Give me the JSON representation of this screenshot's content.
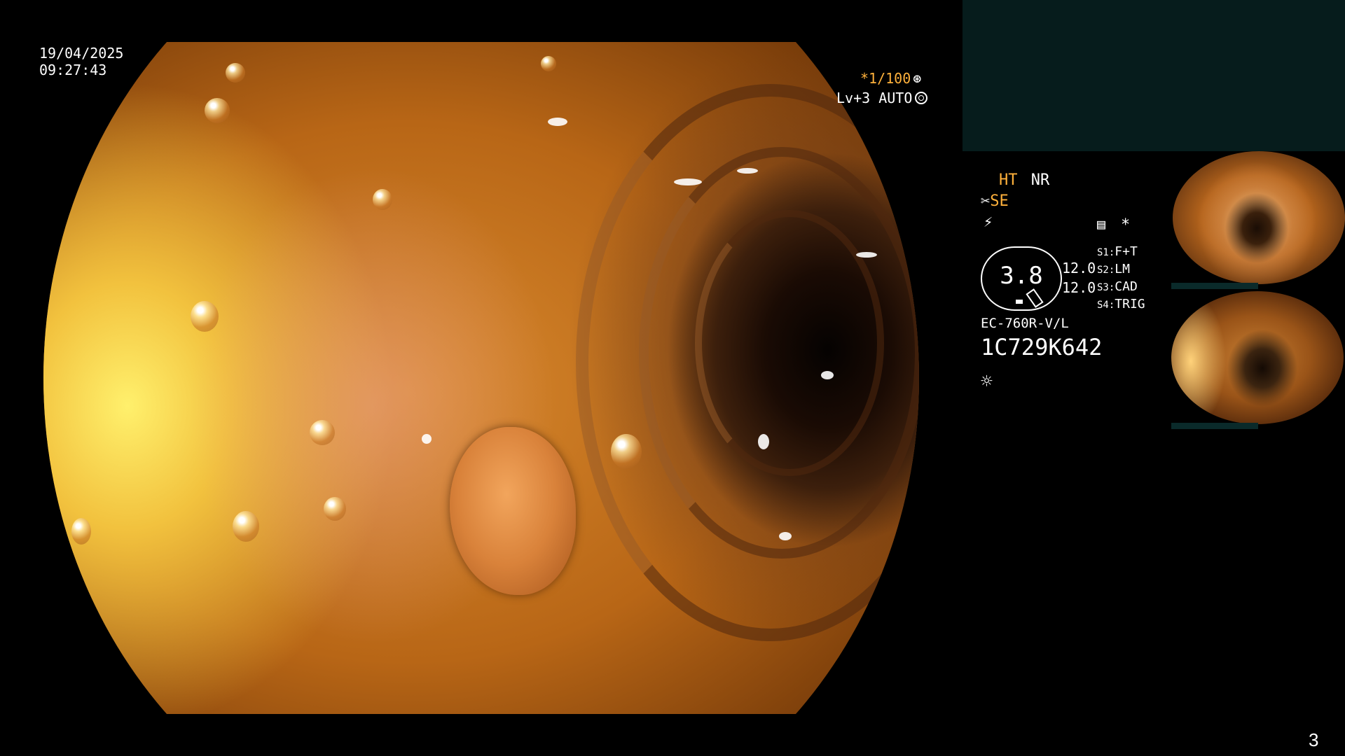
{
  "overlay": {
    "date": "19/04/2025",
    "time": "09:27:43",
    "shutter": "*1/100",
    "level": "Lv+3 AUTO"
  },
  "panel": {
    "ht": "HT",
    "nr": "NR",
    "se": "SE",
    "gauge_value": "3.8",
    "values_top": "12.0",
    "values_bottom": "12.0",
    "s1_label": "S1:",
    "s1_value": "F+T",
    "s2_label": "S2:",
    "s2_value": "LM",
    "s3_label": "S3:",
    "s3_value": "CAD",
    "s4_label": "S4:",
    "s4_value": "TRIG",
    "scope_model": "EC-760R-V/L",
    "scope_serial": "1C729K642",
    "asterisk": "*"
  },
  "page_number": "3",
  "colors": {
    "orange_text": "#ffb13b",
    "teal_box": "#061c1c"
  },
  "icons": [
    "aperture-icon",
    "lens-icon",
    "scissors-icon",
    "bolt-icon",
    "memory-icon",
    "brightness-icon"
  ]
}
